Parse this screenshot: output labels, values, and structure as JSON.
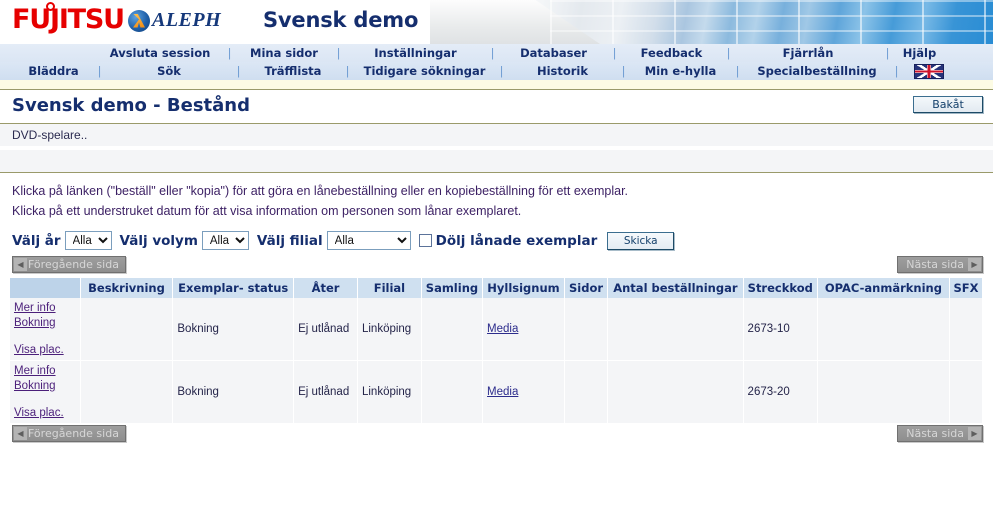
{
  "header": {
    "brand_fujitsu": "FUJITSU",
    "brand_aleph": "ALEPH",
    "site_title": "Svensk demo",
    "accent_red": "#e60000",
    "accent_navy": "#152e6e"
  },
  "nav_row1": [
    {
      "label": "Avsluta session"
    },
    {
      "label": "Mina sidor"
    },
    {
      "label": "Inställningar"
    },
    {
      "label": "Databaser"
    },
    {
      "label": "Feedback"
    },
    {
      "label": "Fjärrlån"
    },
    {
      "label": "Hjälp"
    }
  ],
  "nav_row2": [
    {
      "label": "Bläddra"
    },
    {
      "label": "Sök"
    },
    {
      "label": "Träfflista"
    },
    {
      "label": "Tidigare sökningar"
    },
    {
      "label": "Historik"
    },
    {
      "label": "Min e-hylla"
    },
    {
      "label": "Specialbeställning"
    }
  ],
  "language_flag": "uk-flag-icon",
  "page": {
    "title": "Svensk demo - Bestånd",
    "back_button": "Bakåt"
  },
  "record_info": {
    "line1": "DVD-spelare..",
    "line2": ""
  },
  "instructions": {
    "line1": "Klicka på länken (\"beställ\" eller \"kopia\") för att göra en lånebeställning eller en kopiebeställning för ett exemplar.",
    "line2": "Klicka på ett understruket datum för att visa information om personen som lånar exemplaret."
  },
  "filters": {
    "year_label": "Välj år",
    "year_value": "Alla",
    "volume_label": "Välj volym",
    "volume_value": "Alla",
    "branch_label": "Välj filial",
    "branch_value": "Alla",
    "hide_loaned_label": "Dölj lånade exemplar",
    "hide_loaned_checked": false,
    "submit_label": "Skicka",
    "options": [
      "Alla"
    ]
  },
  "pager": {
    "prev_label": "Föregående sida",
    "next_label": "Nästa sida",
    "prev_enabled": false,
    "next_enabled": false
  },
  "table": {
    "columns": [
      "",
      "Beskrivning",
      "Exemplar- status",
      "Åter",
      "Filial",
      "Samling",
      "Hyllsignum",
      "Sidor",
      "Antal beställningar",
      "Streckkod",
      "OPAC-anmärkning",
      "SFX"
    ],
    "rows": [
      {
        "actions": [
          "Mer info",
          "Bokning",
          "Visa plac."
        ],
        "beskrivning": "",
        "exemplar_status": "Bokning",
        "ater": "Ej utlånad",
        "filial": "Linköping",
        "samling": "",
        "hyllsignum": "Media",
        "sidor": "",
        "antal_bestallningar": "",
        "streckkod": "2673-10",
        "opac_anmarkning": "",
        "sfx": ""
      },
      {
        "actions": [
          "Mer info",
          "Bokning",
          "Visa plac."
        ],
        "beskrivning": "",
        "exemplar_status": "Bokning",
        "ater": "Ej utlånad",
        "filial": "Linköping",
        "samling": "",
        "hyllsignum": "Media",
        "sidor": "",
        "antal_bestallningar": "",
        "streckkod": "2673-20",
        "opac_anmarkning": "",
        "sfx": ""
      }
    ]
  }
}
